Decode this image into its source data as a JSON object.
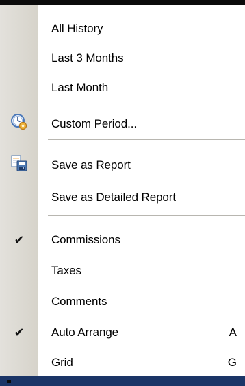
{
  "menu": {
    "items": [
      {
        "label": "All History"
      },
      {
        "label": "Last 3 Months"
      },
      {
        "label": "Last Month"
      },
      {
        "label": "Custom Period...",
        "icon": "clock-gear-icon"
      },
      {
        "label": "Save as Report",
        "icon": "save-report-icon"
      },
      {
        "label": "Save as Detailed Report"
      },
      {
        "label": "Commissions",
        "checked": true
      },
      {
        "label": "Taxes"
      },
      {
        "label": "Comments"
      },
      {
        "label": "Auto Arrange",
        "checked": true,
        "shortcut": "A"
      },
      {
        "label": "Grid",
        "shortcut": "G"
      }
    ]
  },
  "colors": {
    "gutter": "#d9d6cd",
    "separator": "#b8b6b0",
    "top_strip": "#0b0b0b",
    "bottom_strip": "#1b3567"
  }
}
